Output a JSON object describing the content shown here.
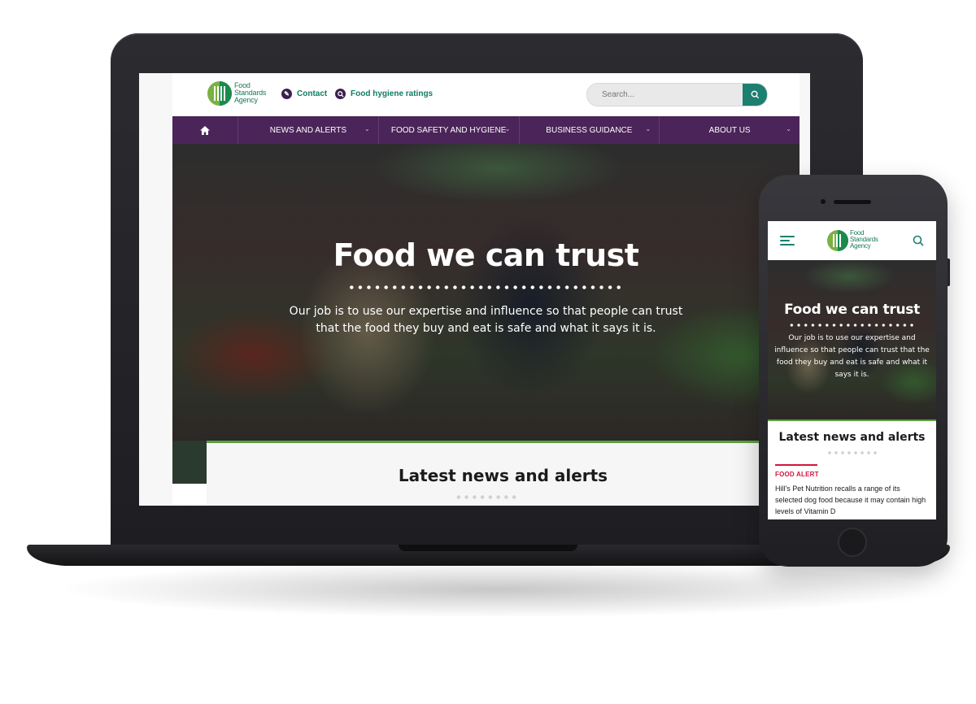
{
  "desktop": {
    "logo": {
      "lines": [
        "Food",
        "Standards",
        "Agency"
      ]
    },
    "header_links": [
      {
        "label": "Contact",
        "icon": "pencil-icon"
      },
      {
        "label": "Food hygiene ratings",
        "icon": "magnifier-icon"
      }
    ],
    "search": {
      "placeholder": "Search...",
      "icon": "search-icon"
    },
    "nav": {
      "home_icon": "home-icon",
      "items": [
        {
          "label": "NEWS AND ALERTS"
        },
        {
          "label": "FOOD SAFETY AND HYGIENE"
        },
        {
          "label": "BUSINESS GUIDANCE"
        },
        {
          "label": "ABOUT US"
        }
      ]
    },
    "hero": {
      "title": "Food we can trust",
      "subtitle": "Our job is to use our expertise and influence so that people can trust that the food they buy and eat is safe and what it says it is."
    },
    "news": {
      "title": "Latest news and alerts"
    }
  },
  "mobile": {
    "logo": {
      "lines": [
        "Food",
        "Standards",
        "Agency"
      ]
    },
    "hero": {
      "title": "Food we can trust",
      "subtitle": "Our job is to use our expertise and influence so that people can trust that the food they buy and eat is safe and what it says it is."
    },
    "news": {
      "title": "Latest news and alerts",
      "tag": "FOOD ALERT",
      "item": "Hill's Pet Nutrition recalls a range of its selected dog food because it may contain high levels of Vitamin D"
    }
  },
  "colors": {
    "nav_purple": "#4b2459",
    "brand_green": "#1a8a4d",
    "accent_teal": "#1d7f6f",
    "alert_red": "#d4153c"
  }
}
